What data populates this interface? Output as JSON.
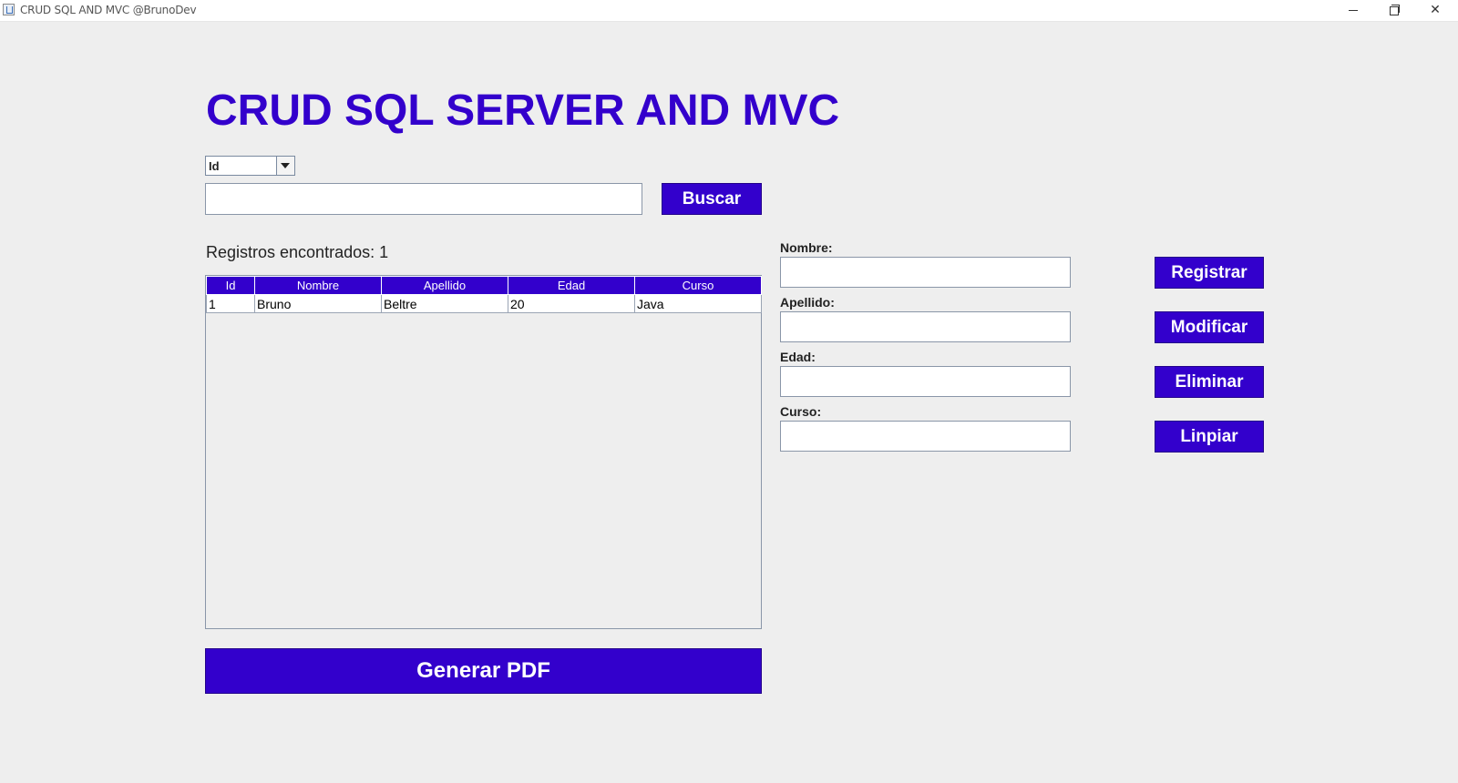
{
  "window": {
    "title": "CRUD SQL AND MVC @BrunoDev",
    "minimize": "–",
    "restore": "❐",
    "close": "✕"
  },
  "header": {
    "title": "CRUD SQL SERVER AND MVC"
  },
  "search": {
    "filter_selected": "Id",
    "input_value": "",
    "button_label": "Buscar"
  },
  "records": {
    "label": "Registros encontrados: 1"
  },
  "table": {
    "columns": [
      "Id",
      "Nombre",
      "Apellido",
      "Edad",
      "Curso"
    ],
    "rows": [
      [
        "1",
        "Bruno",
        "Beltre",
        "20",
        "Java"
      ]
    ]
  },
  "form": {
    "nombre_label": "Nombre:",
    "nombre_value": "",
    "apellido_label": "Apellido:",
    "apellido_value": "",
    "edad_label": "Edad:",
    "edad_value": "",
    "curso_label": "Curso:",
    "curso_value": ""
  },
  "actions": {
    "registrar": "Registrar",
    "modificar": "Modificar",
    "eliminar": "Eliminar",
    "limpiar": "Linpiar",
    "pdf": "Generar PDF"
  },
  "colors": {
    "accent": "#3300cc",
    "background": "#eeeeee"
  }
}
